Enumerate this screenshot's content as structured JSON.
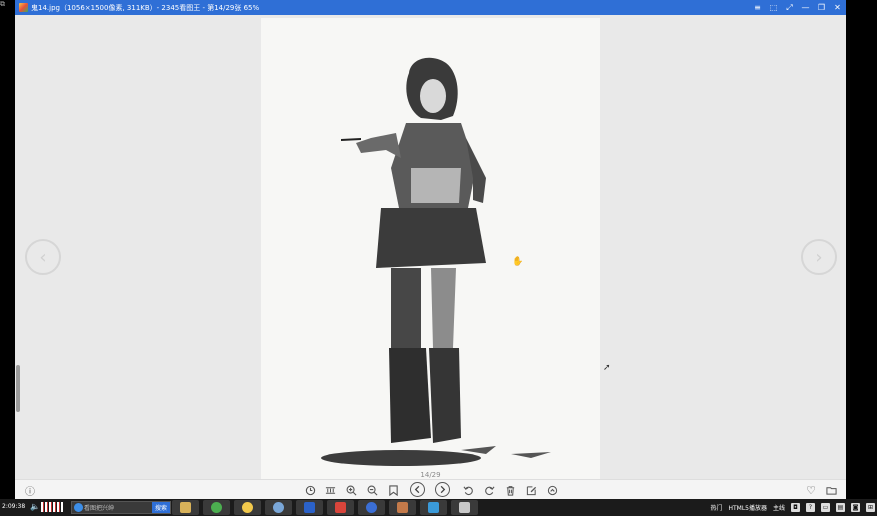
{
  "window": {
    "title": "鬼14.jpg（1056×1500像素, 311KB）- 2345看图王 - 第14/29张 65%",
    "controls": [
      "≡",
      "⬚",
      "⤢",
      "—",
      "❐",
      "✕"
    ]
  },
  "viewer": {
    "page_counter": "14/29",
    "prev_label": "‹",
    "next_label": "›"
  },
  "toolbar": {
    "info_icon": "ⓘ",
    "favorite_icon": "♡",
    "folder_icon": "folder-icon"
  },
  "taskbar": {
    "clock": "2:09:38",
    "search_placeholder": "看图把兴绅",
    "search_button": "搜索",
    "tray_items": [
      "热门",
      "HTML5播放器",
      "主线"
    ],
    "apps": [
      {
        "name": "explorer-app",
        "color": "#d8b25a"
      },
      {
        "name": "browser-green-app",
        "color": "#4caf50"
      },
      {
        "name": "chrome-app",
        "color": "#f2c94c"
      },
      {
        "name": "network-app",
        "color": "#7aa7d8"
      },
      {
        "name": "photoshop-app",
        "color": "#2b62c9"
      },
      {
        "name": "red-app",
        "color": "#d9453b"
      },
      {
        "name": "wps-app",
        "color": "#3b6fd6"
      },
      {
        "name": "media-app",
        "color": "#c47a4a"
      },
      {
        "name": "viewer-app",
        "color": "#3a9ad9"
      },
      {
        "name": "gallery-app",
        "color": "#c9c9c9"
      }
    ]
  },
  "colors": {
    "titlebar": "#2f6fd6",
    "canvas": "#e9e9e9",
    "paper": "#f7f7f5"
  }
}
